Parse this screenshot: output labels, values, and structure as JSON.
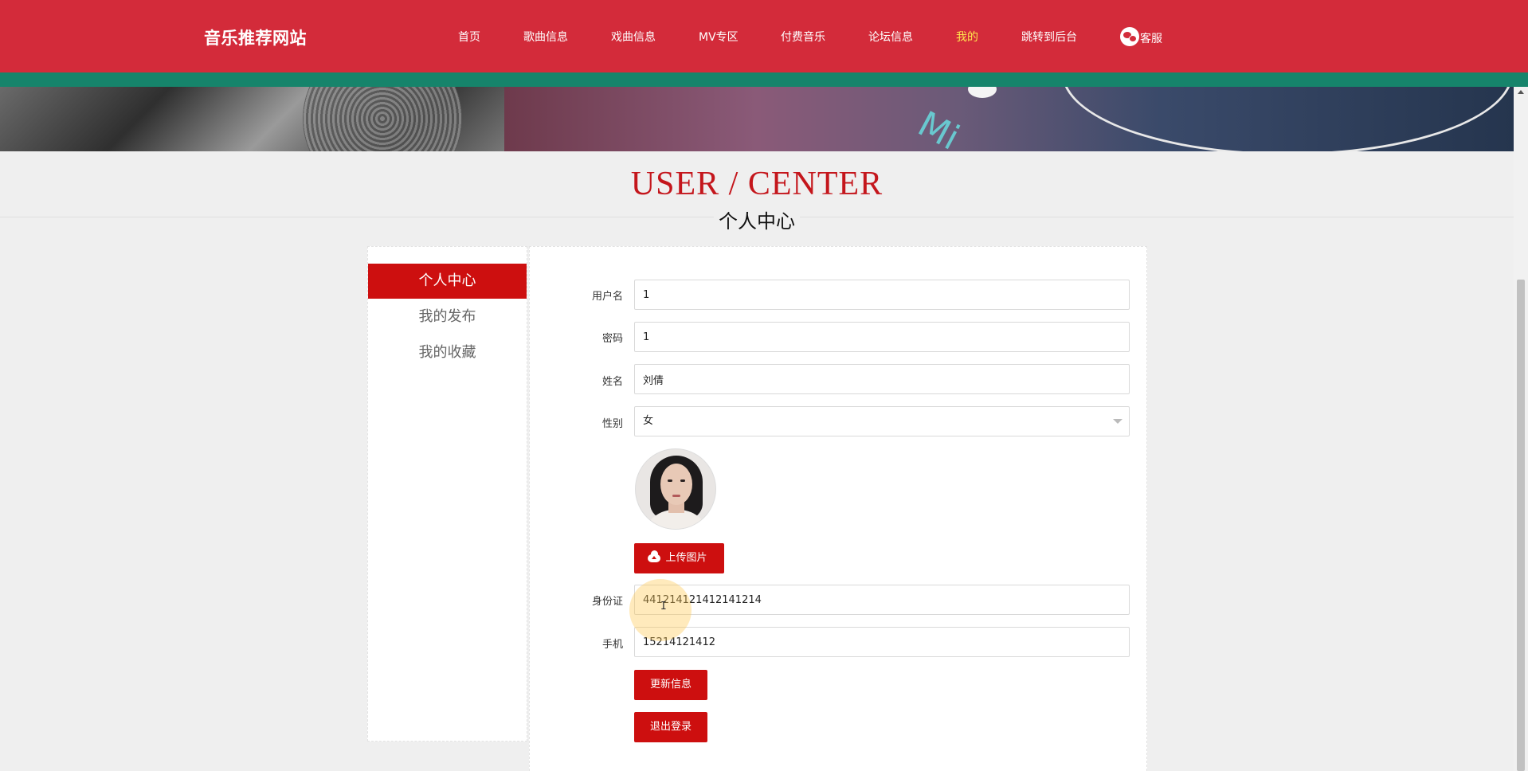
{
  "header": {
    "brand": "音乐推荐网站",
    "nav": [
      {
        "label": "首页",
        "active": false
      },
      {
        "label": "歌曲信息",
        "active": false
      },
      {
        "label": "戏曲信息",
        "active": false
      },
      {
        "label": "MV专区",
        "active": false
      },
      {
        "label": "付费音乐",
        "active": false
      },
      {
        "label": "论坛信息",
        "active": false
      },
      {
        "label": "我的",
        "active": true
      },
      {
        "label": "跳转到后台",
        "active": false
      }
    ],
    "service_label": "客服",
    "colors": {
      "bar": "#d32b3a",
      "stripe": "#16846b",
      "active_nav": "#ffe64d"
    }
  },
  "banner": {
    "text": "Mi"
  },
  "page": {
    "title_en": "USER / CENTER",
    "title_cn": "个人中心"
  },
  "sidebar": {
    "items": [
      {
        "label": "个人中心",
        "active": true
      },
      {
        "label": "我的发布",
        "active": false
      },
      {
        "label": "我的收藏",
        "active": false
      }
    ]
  },
  "form": {
    "username": {
      "label": "用户名",
      "value": "1"
    },
    "password": {
      "label": "密码",
      "value": "1"
    },
    "name": {
      "label": "姓名",
      "value": "刘倩"
    },
    "gender": {
      "label": "性别",
      "value": "女"
    },
    "upload_label": "上传图片",
    "id_card": {
      "label": "身份证",
      "value": "441214121412141214"
    },
    "phone": {
      "label": "手机",
      "value": "15214121412"
    },
    "update_label": "更新信息",
    "logout_label": "退出登录"
  },
  "accent_color": "#cd0f0f"
}
